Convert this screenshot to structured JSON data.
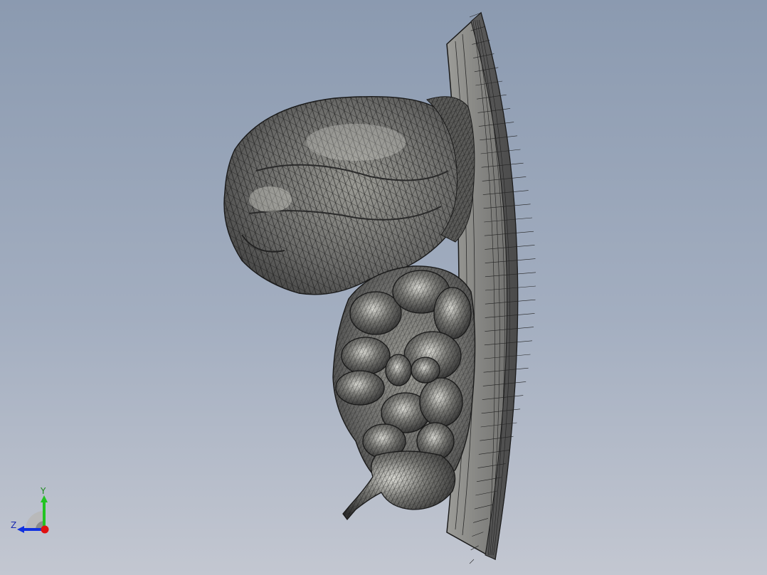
{
  "viewport": {
    "background_top": "#8b9ab0",
    "background_bottom": "#c3c7d1"
  },
  "model": {
    "display_mode": "shaded-with-edges",
    "shade_color": "#6e6e6e",
    "edge_color": "#141414",
    "highlight_color": "#e4e4de"
  },
  "triad": {
    "y_label": "Y",
    "z_label": "Z",
    "x_color": "#e01010",
    "y_color": "#22c422",
    "z_color": "#1030e0"
  }
}
